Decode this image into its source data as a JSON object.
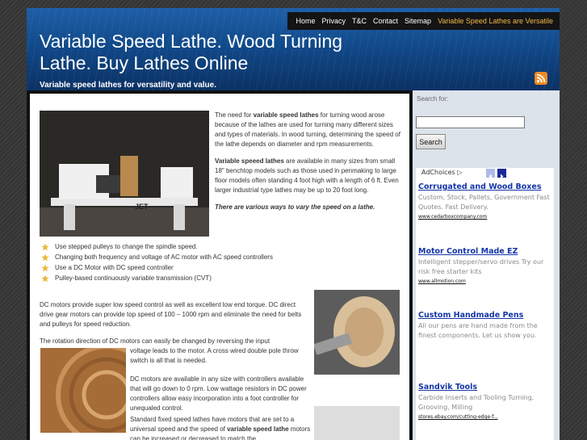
{
  "nav": {
    "items": [
      {
        "label": "Home"
      },
      {
        "label": "Privacy"
      },
      {
        "label": "T&C"
      },
      {
        "label": "Contact"
      },
      {
        "label": "Sitemap"
      },
      {
        "label": "Variable Speed Lathes are Versatile"
      }
    ]
  },
  "header": {
    "title": "Variable Speed Lathe. Wood Turning Lathe. Buy Lathes Online",
    "tagline": "Variable speed lathes for versatility and value.",
    "rss_icon": "rss-feed-icon"
  },
  "article": {
    "intro1_pre": "The need for ",
    "intro1_bold": "variable speed lathes",
    "intro1_post": " for turning wood arose because of the lathes are used for turning many different sizes and types of materials. In wood turning, determining the speed of the lathe depends on diameter and rpm measurements.",
    "intro2_bold": "Variable speeed lathes",
    "intro2_post": " are available in many sizes from small 18\" benchtop models such as those used in penmaking to large floor models often standing 4 foot high with a length of 6 ft.  Even larger industrial type lathes may be up to 20 foot long.",
    "intro3": "There are various ways to vary the speed on a lathe.",
    "bullets": [
      "Use stepped pulleys to change the spindle speed.",
      "Changing both frequency and voltage of AC motor with AC speed controllers",
      "Use a DC Motor with DC speed controller",
      "Pulley-based continuously variable transmission (CVT)"
    ],
    "para1": "DC motors provide super low speed control as well as excellent low end torque. DC direct drive gear motors can provide top speed of 100 – 1000 rpm and eliminate the need for belts and pulleys for speed reduction.",
    "para2": "The rotation direction of DC motors can  easily be changed by reversing the input",
    "para3": "voltage leads to the motor. A cross wired double pole throw switch is all that is needed.",
    "para4": "DC motors are available in any size with controllers available that will go down to 0 rpm. Low wattage resistors in DC power controllers allow easy incorporation into a foot controller for unequaled control.",
    "para5_pre": "Standard fixed speed lathes have motors that are set to a universal speed and the speed of ",
    "para5_bold": "variable speed lathe",
    "para5_post": " motors can be increased or decreased to match the"
  },
  "sidebar": {
    "search_label": "Search for:",
    "search_value": "",
    "search_button": "Search",
    "adchoices": "AdChoices",
    "ads": [
      {
        "title": "Corrugated and Wood Boxes",
        "desc": "Custom, Stock, Pallets, Government Fast Quotes. Fast Delivery.",
        "url": "www.cedarboxcompany.com"
      },
      {
        "title": "Motor Control Made EZ",
        "desc": "Intelligent stepper/servo drives Try our risk free starter kits",
        "url": "www.allmotion.com"
      },
      {
        "title": "Custom Handmade Pens",
        "desc": "All our pens are hand made from the finest components. Let us show you.",
        "url": ""
      },
      {
        "title": "Sandvik Tools",
        "desc": "Carbide Inserts and Tooling Turning, Grooving, Milling",
        "url": "stores.ebay.com/cutting-edge-f..."
      }
    ]
  },
  "colors": {
    "header_blue": "#114a8a",
    "nav_current": "#f2b84a",
    "ad_link": "#1535a8",
    "sidebar_bg": "#dde3ea"
  }
}
